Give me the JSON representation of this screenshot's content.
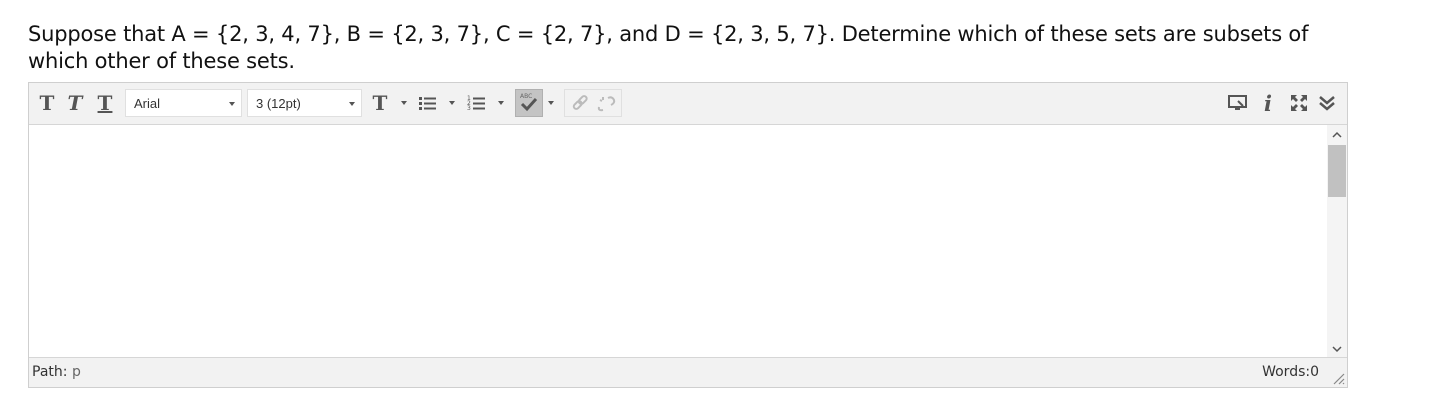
{
  "question": {
    "text": "Suppose that A = {2, 3, 4, 7}, B = {2, 3, 7}, C = {2, 7}, and D = {2, 3, 5, 7}. Determine which of these sets are subsets of which other of these sets."
  },
  "toolbar": {
    "font_family": "Arial",
    "font_size": "3 (12pt)"
  },
  "status": {
    "path_label": "Path:",
    "path_value": "p",
    "word_count": "Words:0"
  },
  "colors": {
    "toolbar_bg": "#f2f2f2",
    "active_button_bg": "#c4c4c4",
    "border": "#cfcfcf"
  }
}
